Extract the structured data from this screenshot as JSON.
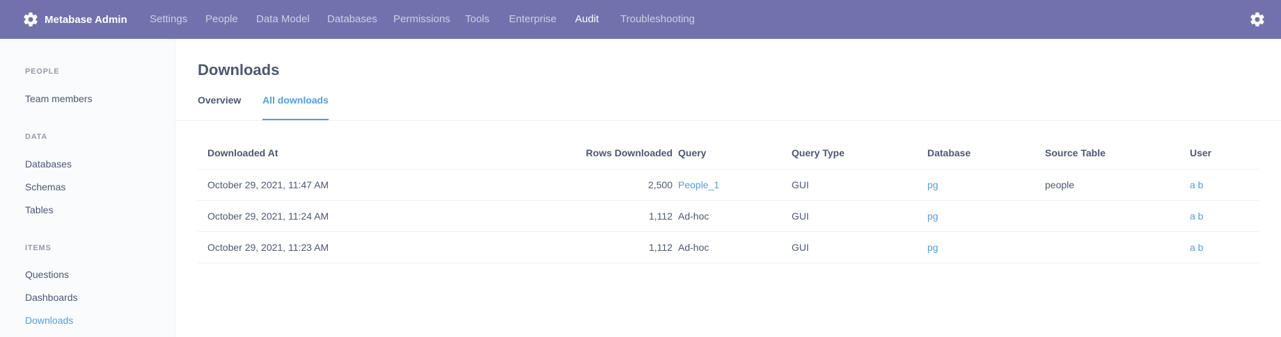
{
  "brand": {
    "label": "Metabase Admin",
    "icon": "gear-icon"
  },
  "nav": {
    "items": [
      {
        "label": "Settings",
        "active": false
      },
      {
        "label": "People",
        "active": false
      },
      {
        "label": "Data Model",
        "active": false
      },
      {
        "label": "Databases",
        "active": false
      },
      {
        "label": "Permissions",
        "active": false
      },
      {
        "label": "Tools",
        "active": false
      },
      {
        "label": "Enterprise",
        "active": false
      },
      {
        "label": "Audit",
        "active": true
      },
      {
        "label": "Troubleshooting",
        "active": false
      }
    ],
    "settings_icon": "gear-icon"
  },
  "sidebar": {
    "sections": [
      {
        "title": "PEOPLE",
        "items": [
          "Team members"
        ]
      },
      {
        "title": "DATA",
        "items": [
          "Databases",
          "Schemas",
          "Tables"
        ]
      },
      {
        "title": "ITEMS",
        "items": [
          "Questions",
          "Dashboards",
          "Downloads"
        ]
      }
    ],
    "active_item": "Downloads"
  },
  "page": {
    "title": "Downloads",
    "tabs": [
      {
        "label": "Overview",
        "active": false
      },
      {
        "label": "All downloads",
        "active": true
      }
    ]
  },
  "table": {
    "columns": [
      "Downloaded At",
      "Rows Downloaded",
      "Query",
      "Query Type",
      "Database",
      "Source Table",
      "User"
    ],
    "rows": [
      {
        "downloaded_at": "October 29, 2021, 11:47 AM",
        "rows": "2,500",
        "query": "People_1",
        "query_is_link": true,
        "query_type": "GUI",
        "database": "pg",
        "source_table": "people",
        "user": "a b"
      },
      {
        "downloaded_at": "October 29, 2021, 11:24 AM",
        "rows": "1,112",
        "query": "Ad-hoc",
        "query_is_link": false,
        "query_type": "GUI",
        "database": "pg",
        "source_table": "",
        "user": "a b"
      },
      {
        "downloaded_at": "October 29, 2021, 11:23 AM",
        "rows": "1,112",
        "query": "Ad-hoc",
        "query_is_link": false,
        "query_type": "GUI",
        "database": "pg",
        "source_table": "",
        "user": "a b"
      }
    ]
  },
  "colors": {
    "nav_bg": "#7172ad",
    "accent": "#509ee3",
    "text": "#4c5773",
    "sidebar_bg": "#f9fbfc"
  }
}
